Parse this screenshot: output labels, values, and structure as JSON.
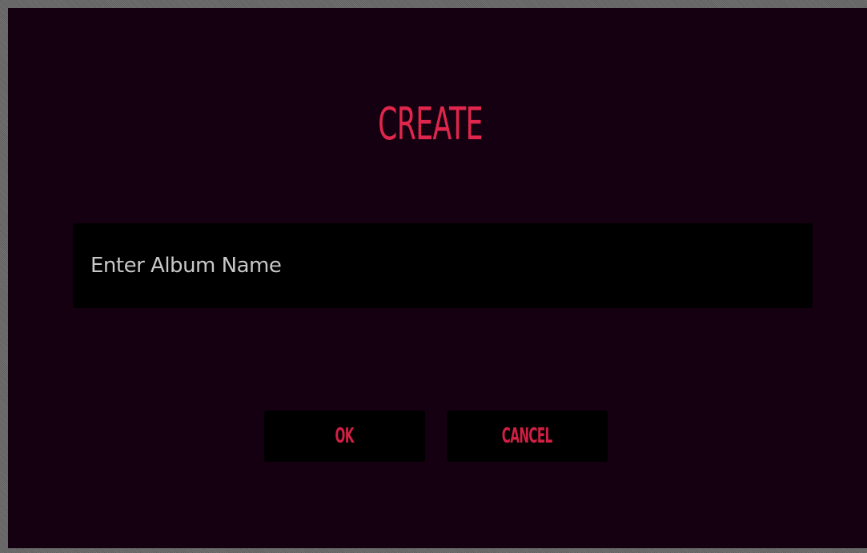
{
  "dialog": {
    "title": "CREATE",
    "album_name_input": {
      "placeholder": "Enter Album Name",
      "value": ""
    },
    "ok_label": "OK",
    "cancel_label": "CANCEL"
  },
  "colors": {
    "background": "#140010",
    "accent": "#e0264c",
    "field": "#000000",
    "placeholder_text": "#c8c8c8"
  }
}
